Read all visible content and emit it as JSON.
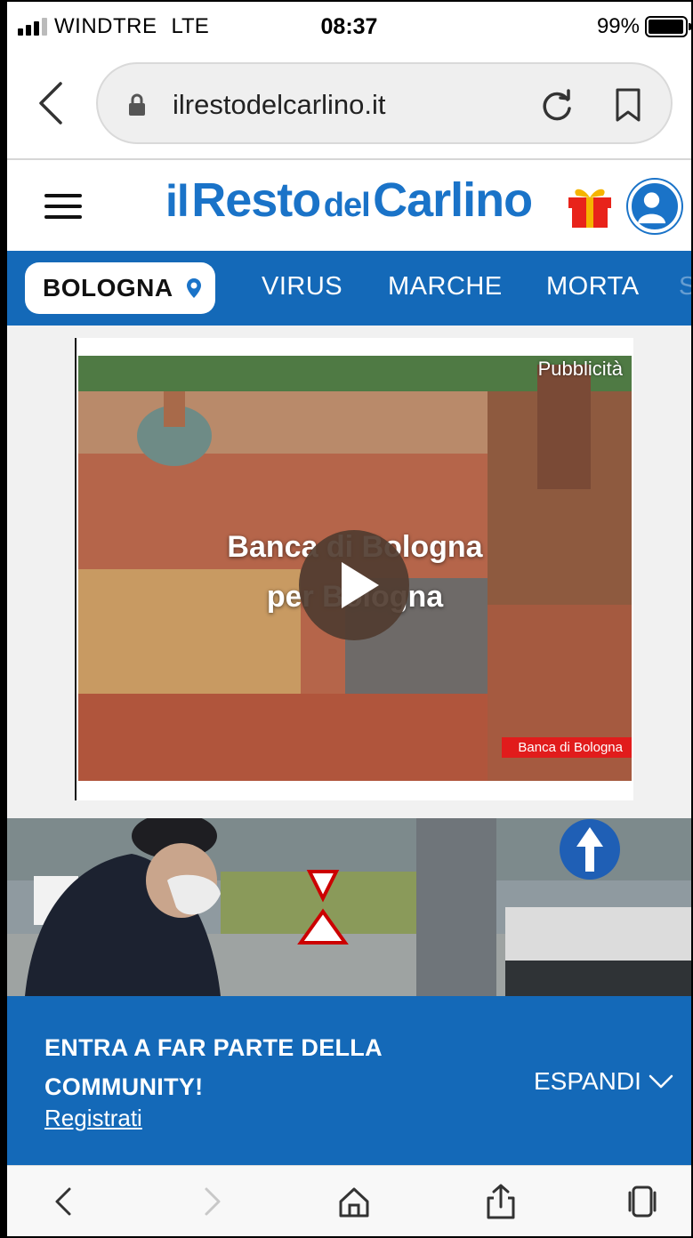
{
  "status_bar": {
    "carrier": "WINDTRE",
    "network": "LTE",
    "time": "08:37",
    "battery": "99%"
  },
  "browser": {
    "url": "ilrestodelcarlino.it"
  },
  "header": {
    "logo_il": "il",
    "logo_resto": "Resto",
    "logo_del": "del",
    "logo_carlino": "Carlino",
    "brand_color": "#1a73c8"
  },
  "nav": {
    "city": "BOLOGNA",
    "items": [
      "VIRUS",
      "MARCHE",
      "MORTA"
    ],
    "bar_color": "#1469b8"
  },
  "ad": {
    "label": "Pubblicità",
    "title_line1": "Banca di Bologna",
    "title_line2": "per Bologna",
    "brand": "Banca di Bologna"
  },
  "community": {
    "title": "ENTRA A FAR PARTE DELLA COMMUNITY!",
    "link": "Registrati",
    "expand": "ESPANDI"
  },
  "icons": {
    "back": "chevron-left-icon",
    "lock": "lock-icon",
    "reload": "reload-icon",
    "bookmark": "bookmark-icon",
    "menu": "hamburger-icon",
    "gift": "gift-icon",
    "account": "user-icon",
    "location": "map-pin-icon",
    "play": "play-icon",
    "home": "home-icon",
    "share": "share-icon",
    "tabs": "tabs-icon"
  }
}
